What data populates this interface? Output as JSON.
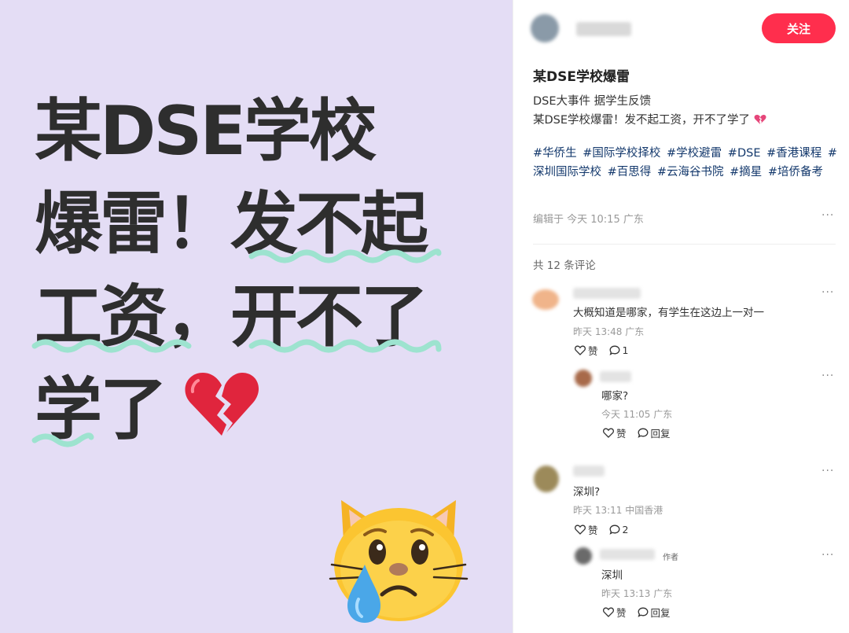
{
  "image": {
    "headline_lines": [
      "某DSE学校",
      "爆雷！",
      "发不起",
      "工资，",
      "开不了",
      "学了"
    ],
    "colors": {
      "background": "#e4ddf5",
      "text": "#2e2e2e",
      "underline": "#9de3cf"
    }
  },
  "post": {
    "follow_label": "关注",
    "title": "某DSE学校爆雷",
    "body_line1": "DSE大事件 据学生反馈",
    "body_line2": "某DSE学校爆雷！发不起工资，开不了学了",
    "tags": [
      "#华侨生",
      "#国际学校择校",
      "#学校避雷",
      "#DSE",
      "#香港课程",
      "#深圳国际学校",
      "#百思得",
      "#云海谷书院",
      "#摘星",
      "#培侨备考"
    ],
    "meta": "编辑于 今天 10:15 广东",
    "comment_count": "共 12 条评论",
    "accent": "#ff2e4d"
  },
  "comments": [
    {
      "text": "大概知道是哪家，有学生在这边上一对一",
      "time": "昨天 13:48 广东",
      "like_label": "赞",
      "reply_count": "1",
      "reply": {
        "text": "哪家?",
        "time": "今天 11:05 广东",
        "like_label": "赞",
        "reply_label": "回复"
      }
    },
    {
      "text": "深圳?",
      "time": "昨天 13:11 中国香港",
      "like_label": "赞",
      "reply_count": "2",
      "reply": {
        "author_tag": "作者",
        "text": "深圳",
        "time": "昨天 13:13 广东",
        "like_label": "赞",
        "reply_label": "回复"
      }
    }
  ],
  "icons": [
    "more-icon",
    "heart-outline-icon",
    "comment-bubble-icon",
    "broken-heart-emoji",
    "crying-cat-emoji"
  ]
}
